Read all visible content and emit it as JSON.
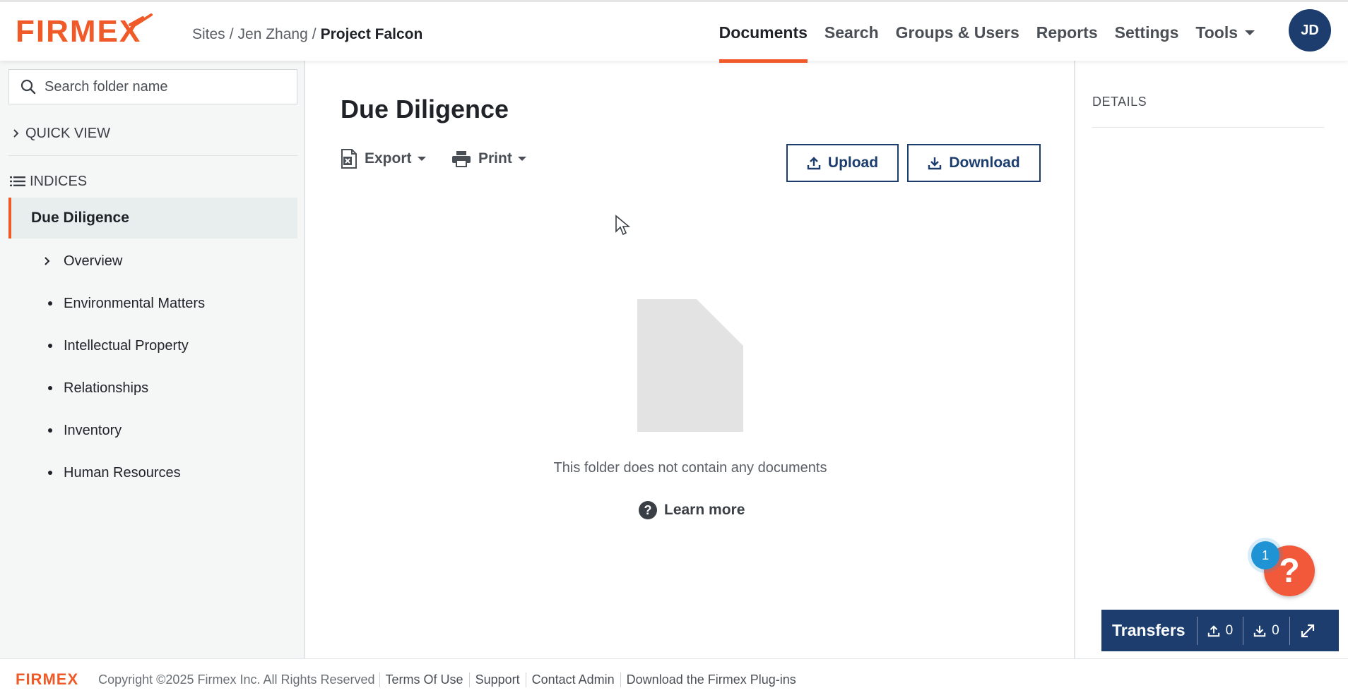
{
  "header": {
    "logo": "FIRMEX",
    "breadcrumb": {
      "sites": "Sites",
      "sep": "/",
      "user": "Jen Zhang",
      "project": "Project Falcon"
    },
    "nav": [
      {
        "label": "Documents",
        "active": true
      },
      {
        "label": "Search"
      },
      {
        "label": "Groups & Users"
      },
      {
        "label": "Reports"
      },
      {
        "label": "Settings"
      },
      {
        "label": "Tools"
      }
    ],
    "avatar": "JD"
  },
  "sidebar": {
    "search_placeholder": "Search folder name",
    "quick_view": "QUICK VIEW",
    "indices": "INDICES",
    "active_folder": "Due Diligence",
    "items": [
      {
        "label": "Overview",
        "marker": "chevron"
      },
      {
        "label": "Environmental Matters",
        "marker": "bullet"
      },
      {
        "label": "Intellectual Property",
        "marker": "bullet"
      },
      {
        "label": "Relationships",
        "marker": "bullet"
      },
      {
        "label": "Inventory",
        "marker": "bullet"
      },
      {
        "label": "Human Resources",
        "marker": "bullet"
      }
    ]
  },
  "main": {
    "title": "Due Diligence",
    "export_label": "Export",
    "print_label": "Print",
    "upload_label": "Upload",
    "download_label": "Download",
    "empty_text": "This folder does not contain any documents",
    "learn_more": "Learn more"
  },
  "details": {
    "title": "DETAILS"
  },
  "help": {
    "badge_count": "1"
  },
  "transfers": {
    "label": "Transfers",
    "uploads": "0",
    "downloads": "0"
  },
  "footer": {
    "logo": "FIRMEX",
    "copyright": "Copyright ©2025 Firmex Inc. All Rights Reserved",
    "links": [
      "Terms Of Use",
      "Support",
      "Contact Admin",
      "Download the Firmex Plug-ins"
    ]
  },
  "colors": {
    "brand_orange": "#ef5a28",
    "navy": "#1c3d6e",
    "sidebar_bg": "#f5f7f7"
  }
}
